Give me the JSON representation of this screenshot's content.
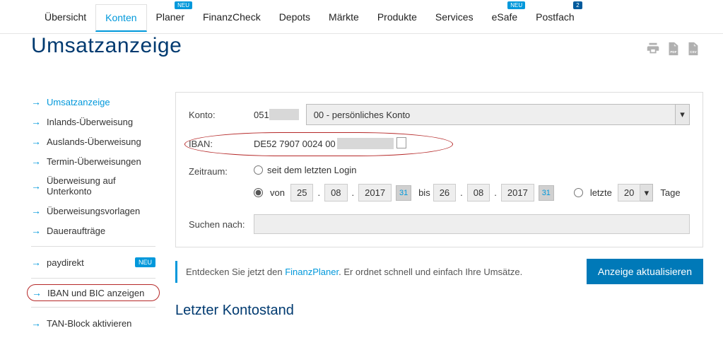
{
  "topnav": {
    "items": [
      {
        "label": "Übersicht"
      },
      {
        "label": "Konten",
        "active": true
      },
      {
        "label": "Planer",
        "badge": "NEU"
      },
      {
        "label": "FinanzCheck"
      },
      {
        "label": "Depots"
      },
      {
        "label": "Märkte"
      },
      {
        "label": "Produkte"
      },
      {
        "label": "Services"
      },
      {
        "label": "eSafe",
        "badge": "NEU"
      },
      {
        "label": "Postfach",
        "badge": "2"
      }
    ]
  },
  "page_title": "Umsatzanzeige",
  "sidebar": [
    {
      "label": "Umsatzanzeige",
      "active": true
    },
    {
      "label": "Inlands-Überweisung"
    },
    {
      "label": "Auslands-Überweisung"
    },
    {
      "label": "Termin-Überweisungen"
    },
    {
      "label": "Überweisung auf Unterkonto"
    },
    {
      "label": "Überweisungsvorlagen"
    },
    {
      "label": "Daueraufträge"
    },
    {
      "divider": true
    },
    {
      "label": "paydirekt",
      "badge": "NEU"
    },
    {
      "divider": true
    },
    {
      "label": "IBAN und BIC anzeigen",
      "circled": true
    },
    {
      "divider": true
    },
    {
      "label": "TAN-Block aktivieren"
    }
  ],
  "form": {
    "konto_label": "Konto:",
    "konto_prefix": "051",
    "konto_selected": "00 - persönliches Konto",
    "iban_label": "IBAN:",
    "iban_value": "DE52 7907 0024 00",
    "zeitraum_label": "Zeitraum:",
    "opt_last_login": "seit dem letzten Login",
    "opt_von": "von",
    "from_d": "25",
    "from_m": "08",
    "from_y": "2017",
    "cal_day": "31",
    "bis": "bis",
    "to_d": "26",
    "to_m": "08",
    "to_y": "2017",
    "opt_letzte": "letzte",
    "letzte_val": "20",
    "tage": "Tage",
    "search_label": "Suchen nach:"
  },
  "hint": {
    "pre": "Entdecken Sie jetzt den ",
    "link": "FinanzPlaner",
    "post": ". Er ordnet schnell und einfach Ihre Umsätze."
  },
  "primary_button": "Anzeige aktualisieren",
  "section_title": "Letzter Kontostand"
}
